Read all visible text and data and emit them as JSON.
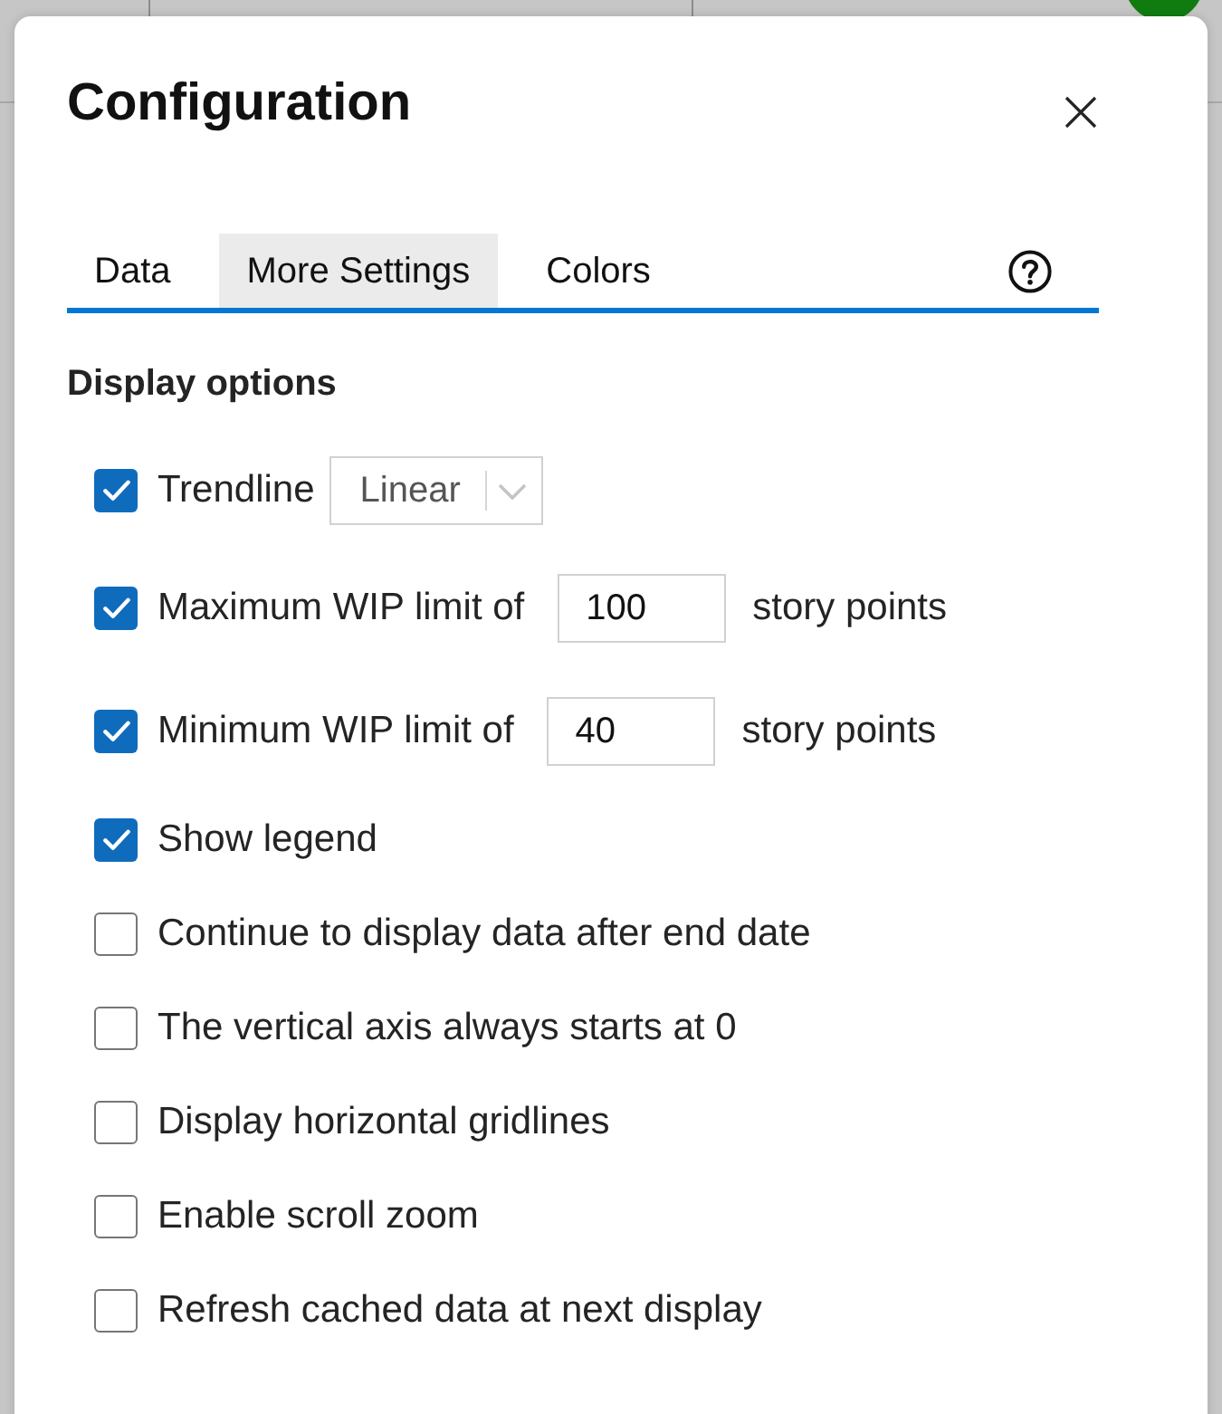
{
  "dialog": {
    "title": "Configuration",
    "tabs": [
      {
        "label": "Data",
        "selected": false
      },
      {
        "label": "More Settings",
        "selected": true
      },
      {
        "label": "Colors",
        "selected": false
      }
    ],
    "section_title": "Display options",
    "options": [
      {
        "kind": "dropdown",
        "label": "Trendline",
        "checked": true,
        "value": "Linear"
      },
      {
        "kind": "number",
        "label": "Maximum WIP limit of",
        "checked": true,
        "value": "100",
        "unit": "story points"
      },
      {
        "kind": "number",
        "label": "Minimum WIP limit of",
        "checked": true,
        "value": "40",
        "unit": "story points"
      },
      {
        "kind": "plain",
        "label": "Show legend",
        "checked": true
      },
      {
        "kind": "plain",
        "label": "Continue to display data after end date",
        "checked": false
      },
      {
        "kind": "plain",
        "label": "The vertical axis always starts at 0",
        "checked": false
      },
      {
        "kind": "plain",
        "label": "Display horizontal gridlines",
        "checked": false
      },
      {
        "kind": "plain",
        "label": "Enable scroll zoom",
        "checked": false
      },
      {
        "kind": "plain",
        "label": "Refresh cached data at next display",
        "checked": false
      }
    ]
  }
}
